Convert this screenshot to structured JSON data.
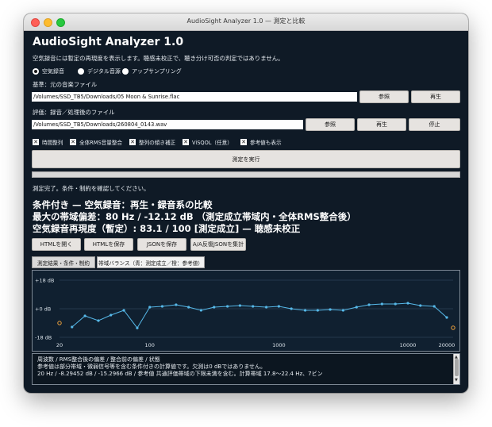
{
  "window": {
    "title": "AudioSight Analyzer 1.0 — 測定と比較"
  },
  "app": {
    "title": "AudioSight Analyzer 1.0",
    "subtitle": "空気録音には暫定の再現度を表示します。聴感未校正で、聴き分け可否の判定ではありません。"
  },
  "modes": [
    {
      "label": "空気録音",
      "selected": true
    },
    {
      "label": "デジタル音源",
      "selected": false
    },
    {
      "label": "アップサンプリング",
      "selected": false
    }
  ],
  "reference": {
    "label": "基準：元の音楽ファイル",
    "path": "/Volumes/SSD_TB5/Downloads/05 Moon & Sunrise.flac",
    "browse": "参照",
    "play": "再生"
  },
  "evaluation": {
    "label": "評価：録音／処理後のファイル",
    "path": "/Volumes/SSD_TB5/Downloads/260804_0143.wav",
    "browse": "参照",
    "play": "再生",
    "stop": "停止"
  },
  "options": [
    {
      "label": "時間整列",
      "checked": true
    },
    {
      "label": "全体RMS音量整合",
      "checked": true
    },
    {
      "label": "整列の傾き補正",
      "checked": true
    },
    {
      "label": "ViSQOL（任意）",
      "checked": true
    },
    {
      "label": "参考値も表示",
      "checked": true
    }
  ],
  "run_button": "測定を実行",
  "progress": {
    "value": 1.0
  },
  "status": "測定完了。条件・制約を確認してください。",
  "results": {
    "line1": "条件付き — 空気録音：再生・録音系の比較",
    "line2": "最大の帯域偏差：80 Hz / -12.12 dB （測定成立帯域内・全体RMS整合後）",
    "line3": "空気録音再現度（暫定）: 83.1 / 100 [測定成立] — 聴感未校正"
  },
  "actions": [
    "HTMLを開く",
    "HTMLを保存",
    "JSONを保存",
    "A/A反復JSONを集計"
  ],
  "tabs": [
    {
      "label": "測定結果・条件・制約",
      "active": true
    },
    {
      "label": "帯域バランス（青：測定成立／橙：参考値）",
      "active": false
    }
  ],
  "chart_data": {
    "type": "line",
    "yticks": [
      "+18 dB",
      "+0 dB",
      "-18 dB"
    ],
    "xticks": [
      "20",
      "100",
      "1000",
      "10000",
      "20000"
    ],
    "xscale": "log",
    "xlim": [
      20,
      20000
    ],
    "ylim": [
      -18,
      18
    ],
    "grid": true,
    "colors": {
      "valid": "#56b8e8",
      "reference": "#f0a23c"
    },
    "valid_points": [
      {
        "x": 25,
        "y": -11.5
      },
      {
        "x": 31.5,
        "y": -4.5
      },
      {
        "x": 40,
        "y": -7.5
      },
      {
        "x": 50,
        "y": -4.0
      },
      {
        "x": 63,
        "y": -1.0
      },
      {
        "x": 80,
        "y": -12.12
      },
      {
        "x": 100,
        "y": 1.0
      },
      {
        "x": 125,
        "y": 1.5
      },
      {
        "x": 160,
        "y": 2.5
      },
      {
        "x": 200,
        "y": 1.0
      },
      {
        "x": 250,
        "y": -1.0
      },
      {
        "x": 315,
        "y": 1.0
      },
      {
        "x": 400,
        "y": 1.5
      },
      {
        "x": 500,
        "y": 2.0
      },
      {
        "x": 630,
        "y": 1.5
      },
      {
        "x": 800,
        "y": 1.0
      },
      {
        "x": 1000,
        "y": 1.5
      },
      {
        "x": 1250,
        "y": 0.0
      },
      {
        "x": 1600,
        "y": -1.0
      },
      {
        "x": 2000,
        "y": -1.0
      },
      {
        "x": 2500,
        "y": -0.5
      },
      {
        "x": 3150,
        "y": -1.0
      },
      {
        "x": 4000,
        "y": 1.0
      },
      {
        "x": 5000,
        "y": 2.5
      },
      {
        "x": 6300,
        "y": 3.0
      },
      {
        "x": 8000,
        "y": 3.0
      },
      {
        "x": 10000,
        "y": 3.5
      },
      {
        "x": 12500,
        "y": 2.0
      },
      {
        "x": 16000,
        "y": 1.5
      },
      {
        "x": 20000,
        "y": -5.5
      }
    ],
    "reference_points": [
      {
        "x": 20,
        "y": -9.0
      },
      {
        "x": 22400,
        "y": -12.0
      }
    ]
  },
  "notes": {
    "line1": "周波数 / RMS整合後の偏差 / 整合前の偏差 / 状態",
    "line2": "参考値は部分帯域・微弱信号等を含む条件付きの計算値です。欠測は0 dBではありません。",
    "line3": "20 Hz / -8.29452 dB / -15.2966 dB / 参考値 共通評価帯域の下限未満を含む。計算帯域 17.8〜22.4 Hz、7ビン"
  }
}
